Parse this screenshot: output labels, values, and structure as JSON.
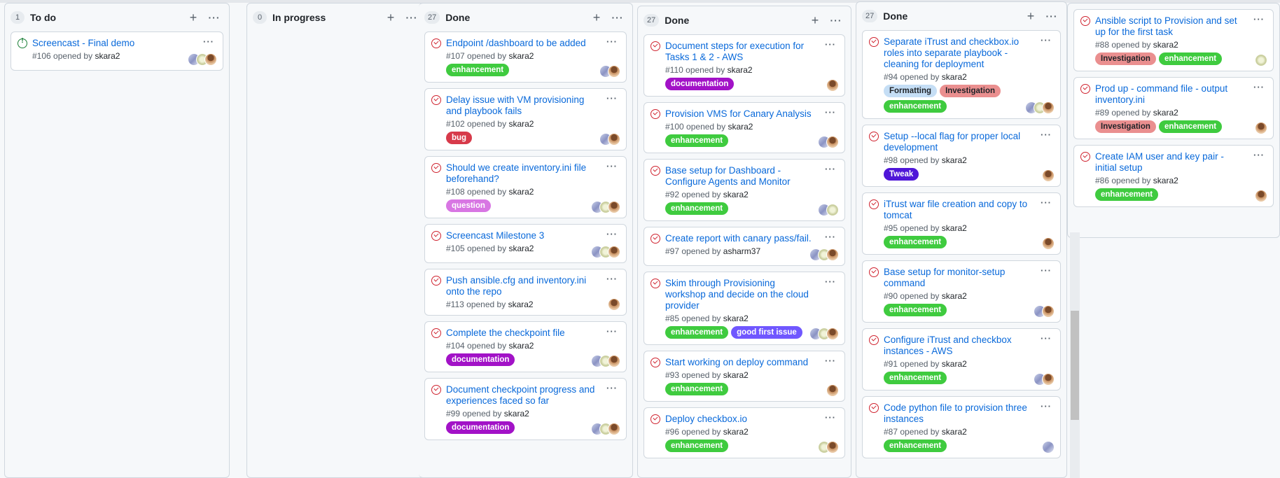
{
  "colors": {
    "enhancement": "#3fcb3f",
    "documentation": "#a212c7",
    "bug": "#d73a4a",
    "question": "#d876e3",
    "good first issue": "#7057ff",
    "Formatting": "#c5def5",
    "Investigation": "#ea8f8f",
    "Tweak": "#4f16d8"
  },
  "columns": [
    {
      "count": "1",
      "title": "To do",
      "show_header": true,
      "cards": [
        {
          "state": "open",
          "title": "Screencast - Final demo",
          "number": "#106",
          "opened": "opened by",
          "author": "skara2",
          "labels": [],
          "avatars": [
            "b",
            "c",
            "a"
          ]
        }
      ]
    },
    {
      "count": "0",
      "title": "In progress",
      "show_header": true,
      "cards": []
    },
    {
      "count": "27",
      "title": "Done",
      "show_header": true,
      "cards": [
        {
          "state": "closed",
          "title": "Endpoint /dashboard to be added",
          "number": "#107",
          "opened": "opened by",
          "author": "skara2",
          "labels": [
            "enhancement"
          ],
          "avatars": [
            "b",
            "a"
          ]
        },
        {
          "state": "closed",
          "title": "Delay issue with VM provisioning and playbook fails",
          "number": "#102",
          "opened": "opened by",
          "author": "skara2",
          "labels": [
            "bug"
          ],
          "avatars": [
            "b",
            "a"
          ]
        },
        {
          "state": "closed",
          "title": "Should we create inventory.ini file beforehand?",
          "number": "#108",
          "opened": "opened by",
          "author": "skara2",
          "labels": [
            "question"
          ],
          "avatars": [
            "b",
            "c",
            "a"
          ]
        },
        {
          "state": "closed",
          "title": "Screencast Milestone 3",
          "number": "#105",
          "opened": "opened by",
          "author": "skara2",
          "labels": [],
          "avatars": [
            "b",
            "c",
            "a"
          ]
        },
        {
          "state": "closed",
          "title": "Push ansible.cfg and inventory.ini onto the repo",
          "number": "#113",
          "opened": "opened by",
          "author": "skara2",
          "labels": [],
          "avatars": [
            "a"
          ]
        },
        {
          "state": "closed",
          "title": "Complete the checkpoint file",
          "number": "#104",
          "opened": "opened by",
          "author": "skara2",
          "labels": [
            "documentation"
          ],
          "avatars": [
            "b",
            "c",
            "a"
          ]
        },
        {
          "state": "closed",
          "title": "Document checkpoint progress and experiences faced so far",
          "number": "#99",
          "opened": "opened by",
          "author": "skara2",
          "labels": [
            "documentation"
          ],
          "avatars": [
            "b",
            "c",
            "a"
          ]
        }
      ]
    },
    {
      "count": "27",
      "title": "Done",
      "show_header": true,
      "cards": [
        {
          "state": "closed",
          "title": "Document steps for execution for Tasks 1 & 2 - AWS",
          "number": "#110",
          "opened": "opened by",
          "author": "skara2",
          "labels": [
            "documentation"
          ],
          "avatars": [
            "a"
          ]
        },
        {
          "state": "closed",
          "title": "Provision VMS for Canary Analysis",
          "number": "#100",
          "opened": "opened by",
          "author": "skara2",
          "labels": [
            "enhancement"
          ],
          "avatars": [
            "b",
            "a"
          ]
        },
        {
          "state": "closed",
          "title": "Base setup for Dashboard - Configure Agents and Monitor",
          "number": "#92",
          "opened": "opened by",
          "author": "skara2",
          "labels": [
            "enhancement"
          ],
          "avatars": [
            "b",
            "c"
          ]
        },
        {
          "state": "closed",
          "title": "Create report with canary pass/fail.",
          "number": "#97",
          "opened": "opened by",
          "author": "asharm37",
          "labels": [],
          "avatars": [
            "b",
            "c",
            "a"
          ]
        },
        {
          "state": "closed",
          "title": "Skim through Provisioning workshop and decide on the cloud provider",
          "number": "#85",
          "opened": "opened by",
          "author": "skara2",
          "labels": [
            "enhancement",
            "good first issue"
          ],
          "avatars": [
            "b",
            "c",
            "a"
          ]
        },
        {
          "state": "closed",
          "title": "Start working on deploy command",
          "number": "#93",
          "opened": "opened by",
          "author": "skara2",
          "labels": [
            "enhancement"
          ],
          "avatars": [
            "a"
          ]
        },
        {
          "state": "closed",
          "title": "Deploy checkbox.io",
          "number": "#96",
          "opened": "opened by",
          "author": "skara2",
          "labels": [
            "enhancement"
          ],
          "avatars": [
            "c",
            "a"
          ]
        }
      ]
    },
    {
      "count": "27",
      "title": "Done",
      "show_header": true,
      "cards": [
        {
          "state": "closed",
          "title": "Separate iTrust and checkbox.io roles into separate playbook - cleaning for deployment",
          "number": "#94",
          "opened": "opened by",
          "author": "skara2",
          "labels": [
            "Formatting",
            "Investigation",
            "enhancement"
          ],
          "avatars": [
            "b",
            "c",
            "a"
          ]
        },
        {
          "state": "closed",
          "title": "Setup --local flag for proper local development",
          "number": "#98",
          "opened": "opened by",
          "author": "skara2",
          "labels": [
            "Tweak"
          ],
          "avatars": [
            "a"
          ]
        },
        {
          "state": "closed",
          "title": "iTrust war file creation and copy to tomcat",
          "number": "#95",
          "opened": "opened by",
          "author": "skara2",
          "labels": [
            "enhancement"
          ],
          "avatars": [
            "a"
          ]
        },
        {
          "state": "closed",
          "title": "Base setup for monitor-setup command",
          "number": "#90",
          "opened": "opened by",
          "author": "skara2",
          "labels": [
            "enhancement"
          ],
          "avatars": [
            "b",
            "a"
          ]
        },
        {
          "state": "closed",
          "title": "Configure iTrust and checkbox instances - AWS",
          "number": "#91",
          "opened": "opened by",
          "author": "skara2",
          "labels": [
            "enhancement"
          ],
          "avatars": [
            "b",
            "a"
          ]
        },
        {
          "state": "closed",
          "title": "Code python file to provision three instances",
          "number": "#87",
          "opened": "opened by",
          "author": "skara2",
          "labels": [
            "enhancement"
          ],
          "avatars": [
            "b"
          ]
        }
      ]
    },
    {
      "count": "",
      "title": "",
      "show_header": false,
      "cards": [
        {
          "state": "closed",
          "title": "Ansible script to Provision and set up for the first task",
          "number": "#88",
          "opened": "opened by",
          "author": "skara2",
          "labels": [
            "Investigation",
            "enhancement"
          ],
          "avatars": [
            "c"
          ]
        },
        {
          "state": "closed",
          "title": "Prod up - command file - output inventory.ini",
          "number": "#89",
          "opened": "opened by",
          "author": "skara2",
          "labels": [
            "Investigation",
            "enhancement"
          ],
          "avatars": [
            "a"
          ]
        },
        {
          "state": "closed",
          "title": "Create IAM user and key pair - initial setup",
          "number": "#86",
          "opened": "opened by",
          "author": "skara2",
          "labels": [
            "enhancement"
          ],
          "avatars": [
            "a"
          ]
        }
      ]
    }
  ]
}
